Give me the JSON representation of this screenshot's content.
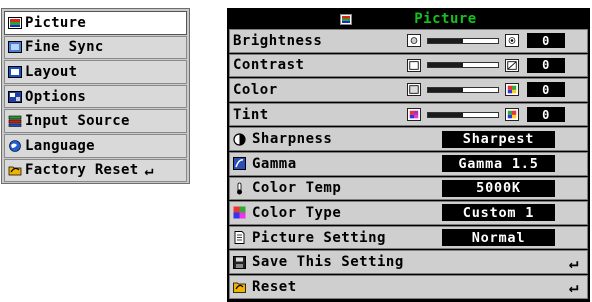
{
  "left_menu": {
    "items": [
      {
        "label": "Picture",
        "icon": "picture-icon",
        "selected": true
      },
      {
        "label": "Fine Sync",
        "icon": "fine-sync-icon",
        "selected": false
      },
      {
        "label": "Layout",
        "icon": "layout-icon",
        "selected": false
      },
      {
        "label": "Options",
        "icon": "options-icon",
        "selected": false
      },
      {
        "label": "Input Source",
        "icon": "input-source-icon",
        "selected": false
      },
      {
        "label": "Language",
        "icon": "language-icon",
        "selected": false
      },
      {
        "label": "Factory Reset",
        "icon": "factory-reset-icon",
        "selected": false
      }
    ],
    "factory_reset_arrow": "↵"
  },
  "panel": {
    "title": "Picture",
    "title_color": "#13c21b",
    "sliders": [
      {
        "label": "Brightness",
        "value": "0",
        "level": 0.5
      },
      {
        "label": "Contrast",
        "value": "0",
        "level": 0.5
      },
      {
        "label": "Color",
        "value": "0",
        "level": 0.5
      },
      {
        "label": "Tint",
        "value": "0",
        "level": 0.5
      }
    ],
    "settings": [
      {
        "label": "Sharpness",
        "value": "Sharpest",
        "icon": "sharpness-icon"
      },
      {
        "label": "Gamma",
        "value": "Gamma 1.5",
        "icon": "gamma-icon"
      },
      {
        "label": "Color Temp",
        "value": "5000K",
        "icon": "color-temp-icon"
      },
      {
        "label": "Color Type",
        "value": "Custom 1",
        "icon": "color-type-icon"
      },
      {
        "label": "Picture Setting",
        "value": "Normal",
        "icon": "picture-setting-icon"
      }
    ],
    "actions": [
      {
        "label": "Save This Setting",
        "icon": "save-icon",
        "arrow": "↵"
      },
      {
        "label": "Reset",
        "icon": "reset-icon",
        "arrow": "↵"
      }
    ]
  }
}
